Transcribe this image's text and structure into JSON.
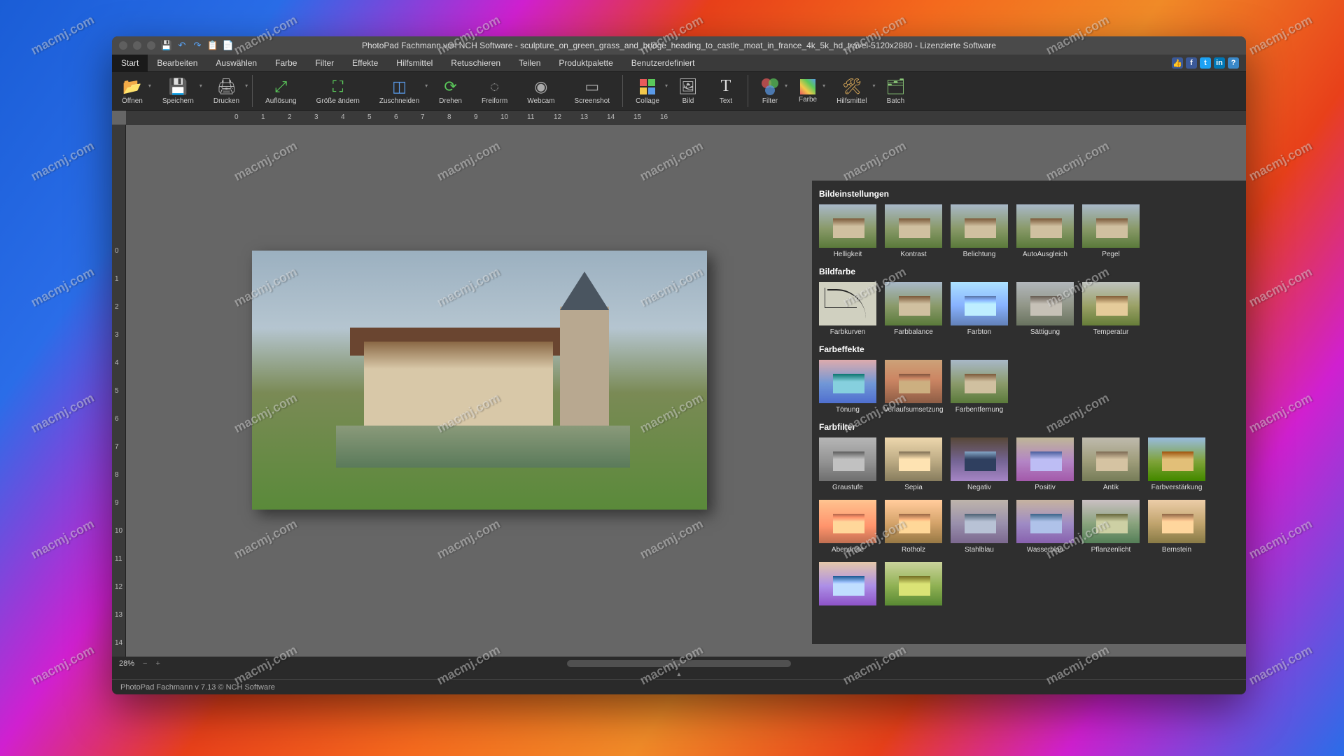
{
  "title": "PhotoPad Fachmann von NCH Software - sculpture_on_green_grass_and_bridge_heading_to_castle_moat_in_france_4k_5k_hd_travel-5120x2880 - Lizenzierte Software",
  "menu": {
    "items": [
      "Start",
      "Bearbeiten",
      "Auswählen",
      "Farbe",
      "Filter",
      "Effekte",
      "Hilfsmittel",
      "Retuschieren",
      "Teilen",
      "Produktpalette",
      "Benutzerdefiniert"
    ]
  },
  "toolbar": {
    "open": "Öffnen",
    "save": "Speichern",
    "print": "Drucken",
    "res": "Auflösung",
    "resize": "Größe ändern",
    "crop": "Zuschneiden",
    "rotate": "Drehen",
    "freeform": "Freiform",
    "webcam": "Webcam",
    "screenshot": "Screenshot",
    "collage": "Collage",
    "image": "Bild",
    "text": "Text",
    "filter": "Filter",
    "color": "Farbe",
    "tools": "Hilfsmittel",
    "batch": "Batch"
  },
  "zoom": "28%",
  "panel": {
    "g1": "Bildeinstellungen",
    "g1items": [
      "Helligkeit",
      "Kontrast",
      "Belichtung",
      "AutoAusgleich",
      "Pegel"
    ],
    "g2": "Bildfarbe",
    "g2items": [
      "Farbkurven",
      "Farbbalance",
      "Farbton",
      "Sättigung",
      "Temperatur"
    ],
    "g3": "Farbeffekte",
    "g3items": [
      "Tönung",
      "Verlaufsumsetzung",
      "Farbentfernung"
    ],
    "g4": "Farbfilter",
    "g4items": [
      "Graustufe",
      "Sepia",
      "Negativ",
      "Positiv",
      "Antik",
      "Farbverstärkung",
      "Abendröte",
      "Rotholz",
      "Stahlblau",
      "Wasserblau",
      "Pflanzenlicht",
      "Bernstein"
    ],
    "g5items": [
      "",
      "",
      ""
    ]
  },
  "footer": "PhotoPad Fachmann v 7.13 © NCH Software",
  "ruler_h": [
    "0",
    "1",
    "2",
    "3",
    "4",
    "5",
    "6",
    "7",
    "8",
    "9",
    "10",
    "11",
    "12",
    "13",
    "14",
    "15",
    "16"
  ],
  "ruler_v": [
    "0",
    "1",
    "2",
    "3",
    "4",
    "5",
    "6",
    "7",
    "8",
    "9",
    "10",
    "11",
    "12",
    "13",
    "14"
  ],
  "watermark": "macmj.com"
}
